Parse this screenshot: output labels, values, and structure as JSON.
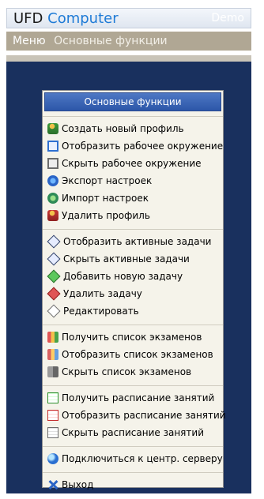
{
  "app": {
    "title_part1": "UFD",
    "title_part2": "Computer",
    "badge": "Demo"
  },
  "menubar": {
    "menu_label": "Меню",
    "section_title": "Основные функции"
  },
  "panel": {
    "header": "Основные функции",
    "groups": [
      [
        {
          "label": "Создать новый профиль",
          "icon": "user-add-icon"
        },
        {
          "label": "Отобразить рабочее окружение",
          "icon": "window-icon"
        },
        {
          "label": "Скрыть рабочее окружение",
          "icon": "window-hide-icon"
        },
        {
          "label": "Экспорт настроек",
          "icon": "export-settings-icon"
        },
        {
          "label": "Импорт настроек",
          "icon": "import-settings-icon"
        },
        {
          "label": "Удалить профиль",
          "icon": "user-delete-icon"
        }
      ],
      [
        {
          "label": "Отобразить активные задачи",
          "icon": "tasks-show-icon"
        },
        {
          "label": "Скрыть активные задачи",
          "icon": "tasks-hide-icon"
        },
        {
          "label": "Добавить новую задачу",
          "icon": "task-add-icon"
        },
        {
          "label": "Удалить задачу",
          "icon": "task-delete-icon"
        },
        {
          "label": "Редактировать",
          "icon": "task-edit-icon"
        }
      ],
      [
        {
          "label": "Получить список экзаменов",
          "icon": "exams-get-icon"
        },
        {
          "label": "Отобразить список экзаменов",
          "icon": "exams-show-icon"
        },
        {
          "label": "Скрыть список экзаменов",
          "icon": "exams-hide-icon"
        }
      ],
      [
        {
          "label": "Получить расписание занятий",
          "icon": "schedule-get-icon"
        },
        {
          "label": "Отобразить расписание занятий",
          "icon": "schedule-show-icon"
        },
        {
          "label": "Скрыть расписание занятий",
          "icon": "schedule-hide-icon"
        }
      ],
      [
        {
          "label": "Подключиться к центр. серверу",
          "icon": "server-connect-icon"
        }
      ],
      [
        {
          "label": "Выход",
          "icon": "exit-icon"
        }
      ]
    ]
  },
  "colors": {
    "desktop_bg": "#19305e",
    "header_blue": "#2c56a8",
    "menubar_bg": "#b0a794"
  }
}
